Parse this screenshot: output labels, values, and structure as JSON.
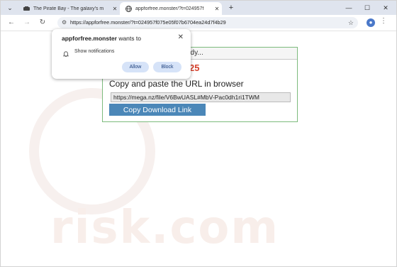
{
  "tabs": [
    {
      "title": "The Pirate Bay - The galaxy's m"
    },
    {
      "title": "appforfree.monster/?t=024957f"
    }
  ],
  "address_bar": {
    "url": "https://appforfree.monster/?t=024957f075e05f07b6704ea24d7f4b29"
  },
  "popup": {
    "site": "appforfree.monster",
    "wants_to": "wants to",
    "permission": "Show notifications",
    "allow_label": "Allow",
    "block_label": "Block"
  },
  "page": {
    "box_heading": "ady...",
    "countdown": "25",
    "copy_title": "Copy and paste the URL in browser",
    "link": "https://mega.nz/file/V6BwUASL#MbV-Pac0dh1ri1TWM",
    "copy_button": "Copy Download Link"
  },
  "watermark": "risk.com",
  "colors": {
    "accent": "#4b87b8",
    "countdown": "#d6402b",
    "box_border": "#7dbb7d"
  }
}
